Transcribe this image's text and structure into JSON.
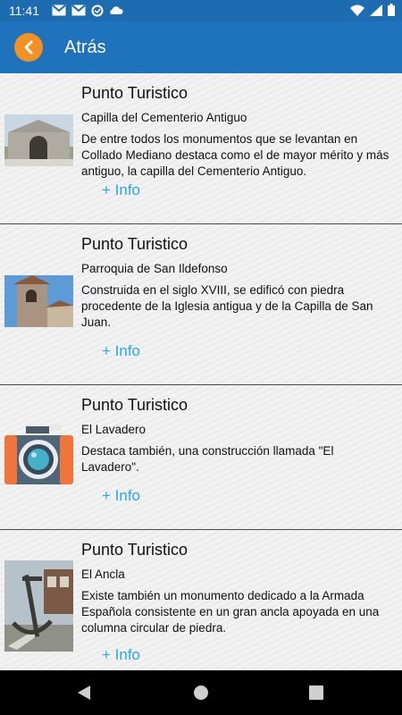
{
  "status": {
    "time": "11:41"
  },
  "app_bar": {
    "back_label": "Atrás"
  },
  "items": [
    {
      "title": "Punto Turistico",
      "subtitle": "Capilla del Cementerio Antiguo",
      "description": "De entre todos los monumentos que se levantan en Collado Mediano destaca como el de mayor mérito y más antiguo, la capilla del Cementerio Antiguo.",
      "link": "+ Info"
    },
    {
      "title": "Punto Turistico",
      "subtitle": "Parroquia de San Ildefonso",
      "description": "Construida en el siglo XVIII, se edificó con piedra procedente de la Iglesia antigua y de la Capilla de San Juan.",
      "link": "+ Info"
    },
    {
      "title": "Punto Turistico",
      "subtitle": "El Lavadero",
      "description": "Destaca también, una construcción llamada \"El Lavadero\".",
      "link": "+ Info"
    },
    {
      "title": "Punto Turistico",
      "subtitle": "El Ancla",
      "description": "Existe también un monumento dedicado a la Armada Española consistente en un gran ancla apoyada en una columna circular de piedra.",
      "link": "+ Info"
    }
  ],
  "colors": {
    "app_bar": "#1f73bd",
    "status_bar": "#1d6bb0",
    "accent": "#f39222",
    "link": "#2aa8e0"
  }
}
